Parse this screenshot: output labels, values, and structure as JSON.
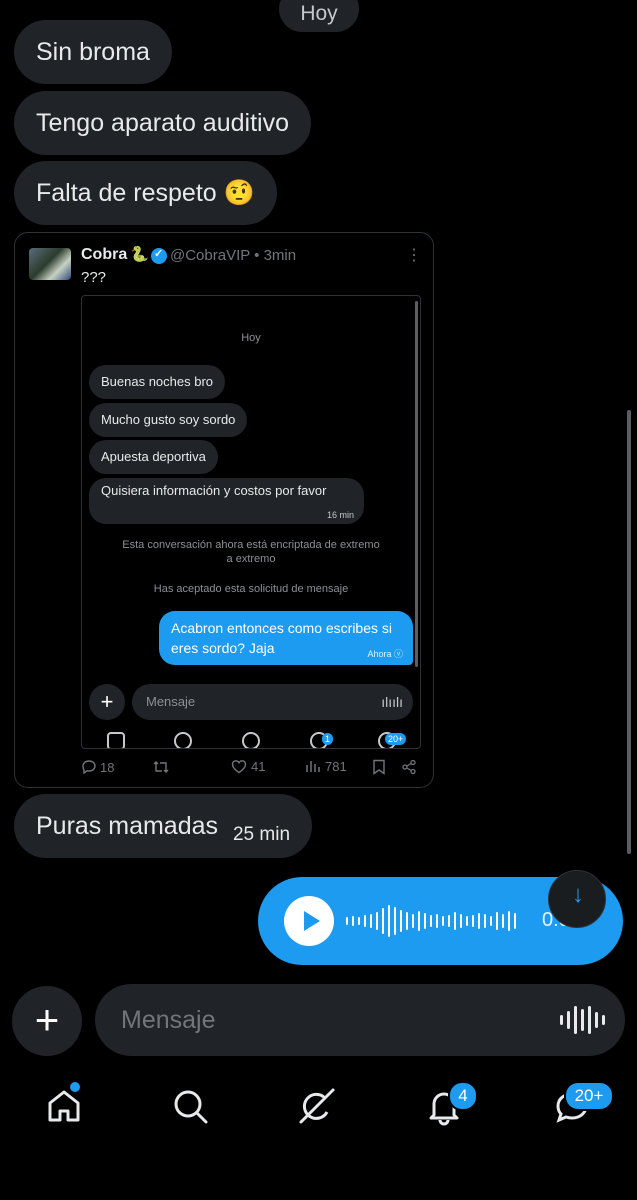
{
  "date_label": "Hoy",
  "messages": [
    {
      "text": "Sin broma"
    },
    {
      "text": "Tengo aparato auditivo"
    },
    {
      "text": "Falta de respeto 🤨"
    }
  ],
  "tweet": {
    "name": "Cobra",
    "name_emoji": "🐍",
    "handle_time": "@CobraVIP • 3min",
    "text": "???",
    "more": "⋮",
    "inner": {
      "date": "Hoy",
      "messages": [
        "Buenas noches bro",
        "Mucho gusto soy sordo",
        "Apuesta deportiva"
      ],
      "long_message": "Quisiera información y costos por favor",
      "long_message_time": "16 min",
      "note_encrypted": "Esta conversación ahora está encriptada de extremo a extremo",
      "note_accepted": "Has aceptado esta solicitud de mensaje",
      "sent_message": "Acabron entonces como escribes si eres sordo? Jaja",
      "sent_time": "Ahora",
      "input_placeholder": "Mensaje",
      "nav_badge_notifications": "1",
      "nav_badge_messages": "20+"
    },
    "actions": {
      "replies": "18",
      "likes": "41",
      "views": "781"
    }
  },
  "last_received": {
    "text": "Puras mamadas",
    "time": "25 min"
  },
  "voice_message": {
    "duration": "0:05"
  },
  "composer": {
    "placeholder": "Mensaje"
  },
  "bottom_nav": {
    "notifications_badge": "4",
    "messages_badge": "20+"
  },
  "colors": {
    "accent": "#1d9bf0",
    "bubble": "#202327",
    "background": "#000000"
  }
}
